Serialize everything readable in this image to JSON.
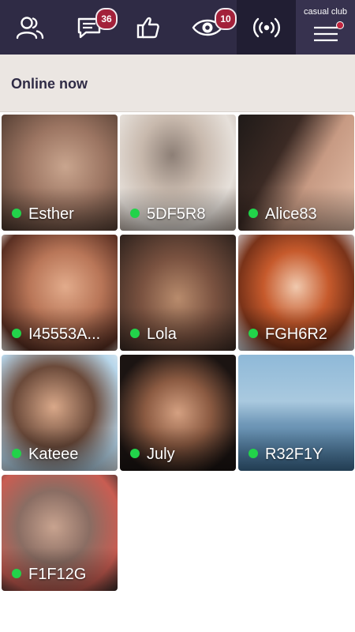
{
  "topbar": {
    "items": [
      {
        "icon": "contacts-icon"
      },
      {
        "icon": "messages-icon",
        "badge": "36"
      },
      {
        "icon": "likes-icon"
      },
      {
        "icon": "visitors-icon",
        "badge": "10"
      },
      {
        "icon": "live-broadcast-icon"
      },
      {
        "icon": "menu-icon",
        "label": "casual club"
      }
    ]
  },
  "section": {
    "title": "Online now"
  },
  "users": [
    {
      "name": "Esther",
      "online": true
    },
    {
      "name": "5DF5R8",
      "online": true
    },
    {
      "name": "Alice83",
      "online": true
    },
    {
      "name": "I45553A...",
      "online": true
    },
    {
      "name": "Lola",
      "online": true
    },
    {
      "name": "FGH6R2",
      "online": true
    },
    {
      "name": "Kateee",
      "online": true
    },
    {
      "name": "July",
      "online": true
    },
    {
      "name": "R32F1Y",
      "online": true
    },
    {
      "name": "F1F12G",
      "online": true
    }
  ],
  "colors": {
    "topbar_bg": "#2f2b45",
    "badge_bg": "#a3213a",
    "online_dot": "#22d34a",
    "section_bg": "#ebe6e2"
  }
}
